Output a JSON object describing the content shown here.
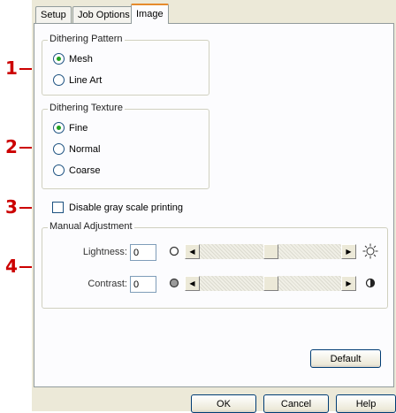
{
  "tabs": [
    {
      "label": "Setup"
    },
    {
      "label": "Job Options"
    },
    {
      "label": "Image"
    }
  ],
  "dithering_pattern": {
    "title": "Dithering Pattern",
    "options": [
      {
        "label": "Mesh",
        "selected": true
      },
      {
        "label": "Line Art",
        "selected": false
      }
    ]
  },
  "dithering_texture": {
    "title": "Dithering Texture",
    "options": [
      {
        "label": "Fine",
        "selected": true
      },
      {
        "label": "Normal",
        "selected": false
      },
      {
        "label": "Coarse",
        "selected": false
      }
    ]
  },
  "gray_scale": {
    "label": "Disable gray scale printing",
    "checked": false
  },
  "manual_adjustment": {
    "title": "Manual Adjustment",
    "lightness": {
      "label": "Lightness:",
      "value": "0",
      "slider_fraction": 0.5
    },
    "contrast": {
      "label": "Contrast:",
      "value": "0",
      "slider_fraction": 0.5
    }
  },
  "buttons": {
    "default": "Default",
    "ok": "OK",
    "cancel": "Cancel",
    "help": "Help"
  },
  "callouts": [
    "1",
    "2",
    "3",
    "4"
  ],
  "colors": {
    "callout": "#cc0000",
    "radio_dot": "#21a121",
    "active_tab_accent": "#e68b2c"
  },
  "icons": {
    "lightness_low": "hollow-circle-icon",
    "lightness_high": "sun-icon",
    "contrast_low": "gray-circle-icon",
    "contrast_high": "half-circle-icon"
  }
}
